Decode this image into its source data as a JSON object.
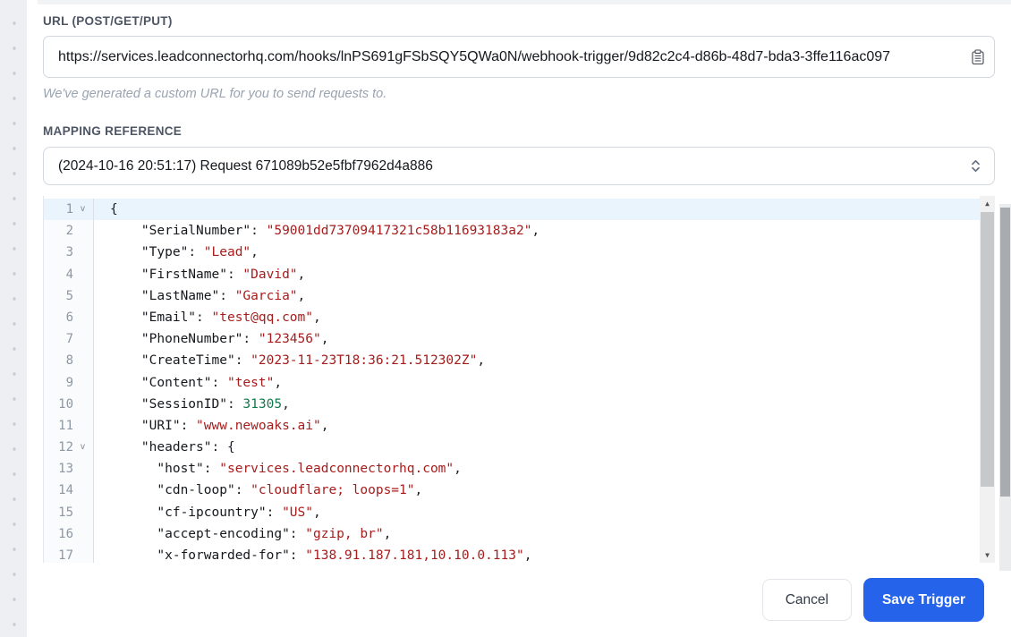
{
  "url_section": {
    "label": "URL (POST/GET/PUT)",
    "url_value": "https://services.leadconnectorhq.com/hooks/lnPS691gFSbSQY5QWa0N/webhook-trigger/9d82c2c4-d86b-48d7-bda3-3ffe116ac097",
    "copy_icon": "clipboard-icon",
    "helper_text": "We've generated a custom URL for you to send requests to."
  },
  "mapping_section": {
    "label": "MAPPING REFERENCE",
    "selected_option": "(2024-10-16 20:51:17) Request 671089b52e5fbf7962d4a886",
    "dropdown_icon": "select-chevrons-icon"
  },
  "editor": {
    "language": "json",
    "active_line": 1,
    "fold_icon": "fold-arrow-icon",
    "scrollbar_icons": [
      "scroll-up-icon",
      "scroll-down-icon"
    ],
    "lines": [
      {
        "n": 1,
        "fold": true,
        "tokens": [
          [
            "p",
            "{"
          ]
        ]
      },
      {
        "n": 2,
        "fold": false,
        "tokens": [
          [
            "p",
            "    "
          ],
          [
            "k",
            "\"SerialNumber\""
          ],
          [
            "p",
            ": "
          ],
          [
            "s",
            "\"59001dd73709417321c58b11693183a2\""
          ],
          [
            "p",
            ","
          ]
        ]
      },
      {
        "n": 3,
        "fold": false,
        "tokens": [
          [
            "p",
            "    "
          ],
          [
            "k",
            "\"Type\""
          ],
          [
            "p",
            ": "
          ],
          [
            "s",
            "\"Lead\""
          ],
          [
            "p",
            ","
          ]
        ]
      },
      {
        "n": 4,
        "fold": false,
        "tokens": [
          [
            "p",
            "    "
          ],
          [
            "k",
            "\"FirstName\""
          ],
          [
            "p",
            ": "
          ],
          [
            "s",
            "\"David\""
          ],
          [
            "p",
            ","
          ]
        ]
      },
      {
        "n": 5,
        "fold": false,
        "tokens": [
          [
            "p",
            "    "
          ],
          [
            "k",
            "\"LastName\""
          ],
          [
            "p",
            ": "
          ],
          [
            "s",
            "\"Garcia\""
          ],
          [
            "p",
            ","
          ]
        ]
      },
      {
        "n": 6,
        "fold": false,
        "tokens": [
          [
            "p",
            "    "
          ],
          [
            "k",
            "\"Email\""
          ],
          [
            "p",
            ": "
          ],
          [
            "s",
            "\"test@qq.com\""
          ],
          [
            "p",
            ","
          ]
        ]
      },
      {
        "n": 7,
        "fold": false,
        "tokens": [
          [
            "p",
            "    "
          ],
          [
            "k",
            "\"PhoneNumber\""
          ],
          [
            "p",
            ": "
          ],
          [
            "s",
            "\"123456\""
          ],
          [
            "p",
            ","
          ]
        ]
      },
      {
        "n": 8,
        "fold": false,
        "tokens": [
          [
            "p",
            "    "
          ],
          [
            "k",
            "\"CreateTime\""
          ],
          [
            "p",
            ": "
          ],
          [
            "s",
            "\"2023-11-23T18:36:21.512302Z\""
          ],
          [
            "p",
            ","
          ]
        ]
      },
      {
        "n": 9,
        "fold": false,
        "tokens": [
          [
            "p",
            "    "
          ],
          [
            "k",
            "\"Content\""
          ],
          [
            "p",
            ": "
          ],
          [
            "s",
            "\"test\""
          ],
          [
            "p",
            ","
          ]
        ]
      },
      {
        "n": 10,
        "fold": false,
        "tokens": [
          [
            "p",
            "    "
          ],
          [
            "k",
            "\"SessionID\""
          ],
          [
            "p",
            ": "
          ],
          [
            "n",
            "31305"
          ],
          [
            "p",
            ","
          ]
        ]
      },
      {
        "n": 11,
        "fold": false,
        "tokens": [
          [
            "p",
            "    "
          ],
          [
            "k",
            "\"URI\""
          ],
          [
            "p",
            ": "
          ],
          [
            "s",
            "\"www.newoaks.ai\""
          ],
          [
            "p",
            ","
          ]
        ]
      },
      {
        "n": 12,
        "fold": true,
        "tokens": [
          [
            "p",
            "    "
          ],
          [
            "k",
            "\"headers\""
          ],
          [
            "p",
            ": {"
          ]
        ]
      },
      {
        "n": 13,
        "fold": false,
        "tokens": [
          [
            "p",
            "      "
          ],
          [
            "k",
            "\"host\""
          ],
          [
            "p",
            ": "
          ],
          [
            "s",
            "\"services.leadconnectorhq.com\""
          ],
          [
            "p",
            ","
          ]
        ]
      },
      {
        "n": 14,
        "fold": false,
        "tokens": [
          [
            "p",
            "      "
          ],
          [
            "k",
            "\"cdn-loop\""
          ],
          [
            "p",
            ": "
          ],
          [
            "s",
            "\"cloudflare; loops=1\""
          ],
          [
            "p",
            ","
          ]
        ]
      },
      {
        "n": 15,
        "fold": false,
        "tokens": [
          [
            "p",
            "      "
          ],
          [
            "k",
            "\"cf-ipcountry\""
          ],
          [
            "p",
            ": "
          ],
          [
            "s",
            "\"US\""
          ],
          [
            "p",
            ","
          ]
        ]
      },
      {
        "n": 16,
        "fold": false,
        "tokens": [
          [
            "p",
            "      "
          ],
          [
            "k",
            "\"accept-encoding\""
          ],
          [
            "p",
            ": "
          ],
          [
            "s",
            "\"gzip, br\""
          ],
          [
            "p",
            ","
          ]
        ]
      },
      {
        "n": 17,
        "fold": false,
        "tokens": [
          [
            "p",
            "      "
          ],
          [
            "k",
            "\"x-forwarded-for\""
          ],
          [
            "p",
            ": "
          ],
          [
            "s",
            "\"138.91.187.181,10.10.0.113\""
          ],
          [
            "p",
            ","
          ]
        ]
      }
    ]
  },
  "footer": {
    "cancel_label": "Cancel",
    "save_label": "Save Trigger"
  },
  "colors": {
    "accent": "#2563eb",
    "string_token": "#a61d1d",
    "number_token": "#15794f",
    "key_token": "#15181d",
    "active_line_bg": "#eaf4fd"
  }
}
